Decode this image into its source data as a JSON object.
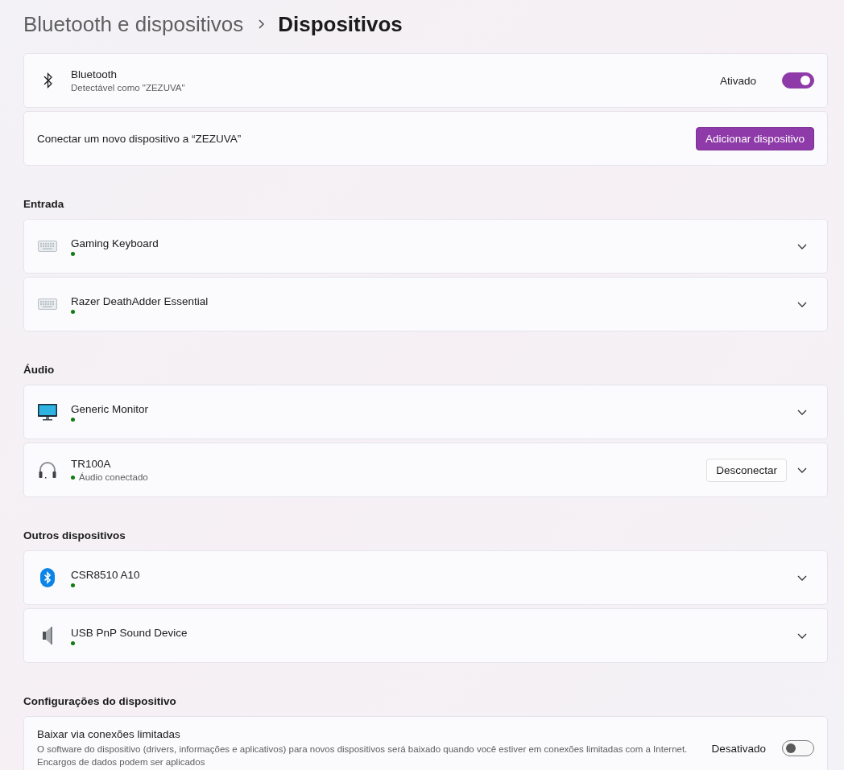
{
  "breadcrumb": {
    "parent": "Bluetooth e dispositivos",
    "current": "Dispositivos"
  },
  "bluetooth": {
    "title": "Bluetooth",
    "subtitle": "Detectável como \"ZEZUVA\"",
    "state_label": "Ativado",
    "on": true
  },
  "add_device": {
    "label": "Conectar um novo dispositivo a “ZEZUVA”",
    "button": "Adicionar dispositivo"
  },
  "sections": [
    {
      "title": "Entrada",
      "devices": [
        {
          "kind": "keyboard",
          "name": "Gaming Keyboard",
          "connected": true,
          "expanded": false
        },
        {
          "kind": "keyboard",
          "name": "Razer DeathAdder Essential",
          "connected": true,
          "expanded": false
        }
      ]
    },
    {
      "title": "Áudio",
      "devices": [
        {
          "kind": "monitor",
          "name": "Generic Monitor",
          "connected": true,
          "expanded": false
        },
        {
          "kind": "headphones",
          "name": "TR100A",
          "connected": true,
          "status": "Áudio conectado",
          "button": "Desconectar",
          "expanded": false
        }
      ]
    },
    {
      "title": "Outros dispositivos",
      "devices": [
        {
          "kind": "bluetooth",
          "name": "CSR8510 A10",
          "connected": true,
          "expanded": false
        },
        {
          "kind": "speaker",
          "name": "USB PnP Sound Device",
          "connected": true,
          "expanded": false
        }
      ]
    }
  ],
  "device_settings": {
    "title": "Configurações do dispositivo",
    "items": [
      {
        "title": "Baixar via conexões limitadas",
        "description": "O software do dispositivo (drivers, informações e aplicativos) para novos dispositivos será baixado quando você estiver em conexões limitadas com a Internet. Encargos de dados podem ser aplicados",
        "state_label": "Desativado",
        "on": false
      }
    ]
  }
}
